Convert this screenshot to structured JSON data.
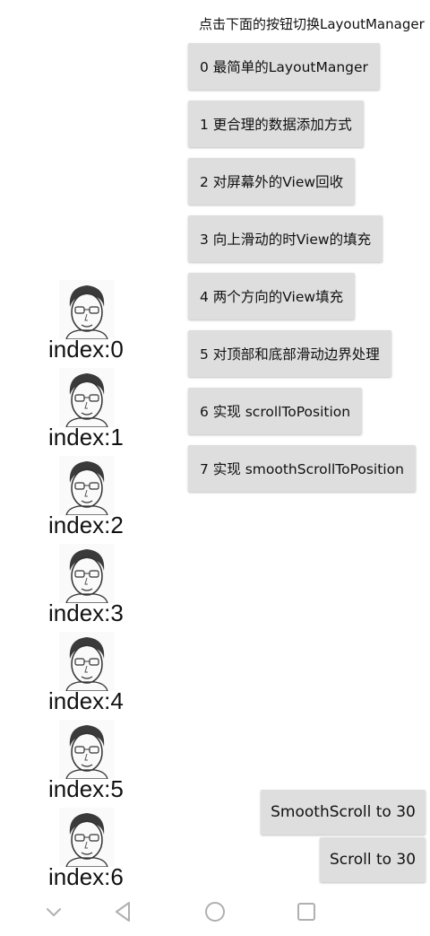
{
  "header": {
    "text": "点击下面的按钮切换LayoutManager"
  },
  "menu": [
    {
      "label": "0 最简单的LayoutManger"
    },
    {
      "label": "1 更合理的数据添加方式"
    },
    {
      "label": "2 对屏幕外的View回收"
    },
    {
      "label": "3 向上滑动的时View的填充"
    },
    {
      "label": "4 两个方向的View填充"
    },
    {
      "label": "5 对顶部和底部滑动边界处理"
    },
    {
      "label": "6 实现 scrollToPosition"
    },
    {
      "label": "7 实现 smoothScrollToPosition"
    }
  ],
  "list": {
    "items": [
      {
        "label": "index:0"
      },
      {
        "label": "index:1"
      },
      {
        "label": "index:2"
      },
      {
        "label": "index:3"
      },
      {
        "label": "index:4"
      },
      {
        "label": "index:5"
      },
      {
        "label": "index:6"
      }
    ]
  },
  "actions": {
    "smooth_scroll": "SmoothScroll to 30",
    "scroll": "Scroll to 30"
  },
  "navbar": {
    "icons": [
      "chevron-down-icon",
      "back-triangle-icon",
      "home-circle-icon",
      "recents-square-icon"
    ],
    "icon_color": "#b0b0b0"
  }
}
